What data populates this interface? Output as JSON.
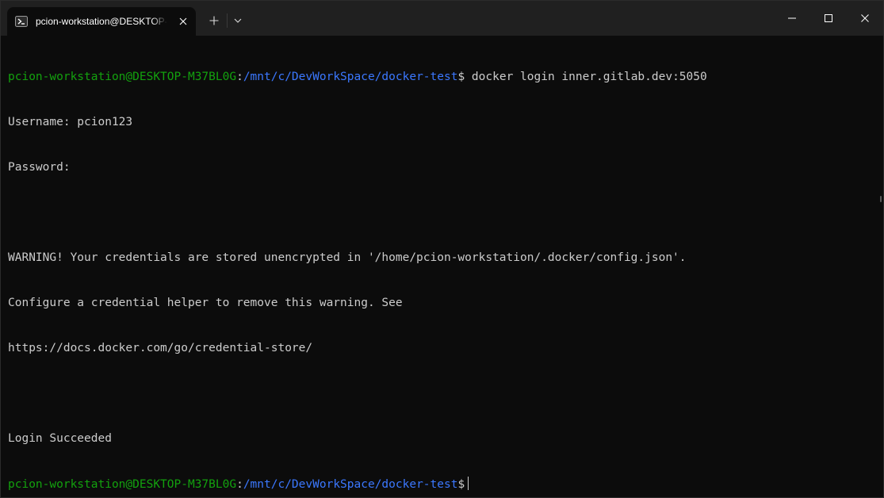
{
  "window": {
    "tab_title": "pcion-workstation@DESKTOP-",
    "tab_icon": "powershell-icon",
    "new_tab_icon": "plus-icon",
    "dropdown_icon": "chevron-down-icon",
    "minimize_icon": "minimize-icon",
    "maximize_icon": "maximize-icon",
    "close_icon": "close-icon"
  },
  "prompt": {
    "user_host": "pcion-workstation@DESKTOP-M37BL0G",
    "colon": ":",
    "path": "/mnt/c/DevWorkSpace/docker-test",
    "dollar": "$"
  },
  "terminal": {
    "command": " docker login inner.gitlab.dev:5050",
    "output": [
      "Username: pcion123",
      "Password:",
      "",
      "WARNING! Your credentials are stored unencrypted in '/home/pcion-workstation/.docker/config.json'.",
      "Configure a credential helper to remove this warning. See",
      "https://docs.docker.com/go/credential-store/",
      "",
      "Login Succeeded"
    ]
  },
  "colors": {
    "background": "#0c0c0c",
    "titlebar": "#202020",
    "prompt_user": "#13a10e",
    "prompt_path": "#3b78ff",
    "text": "#cccccc"
  }
}
